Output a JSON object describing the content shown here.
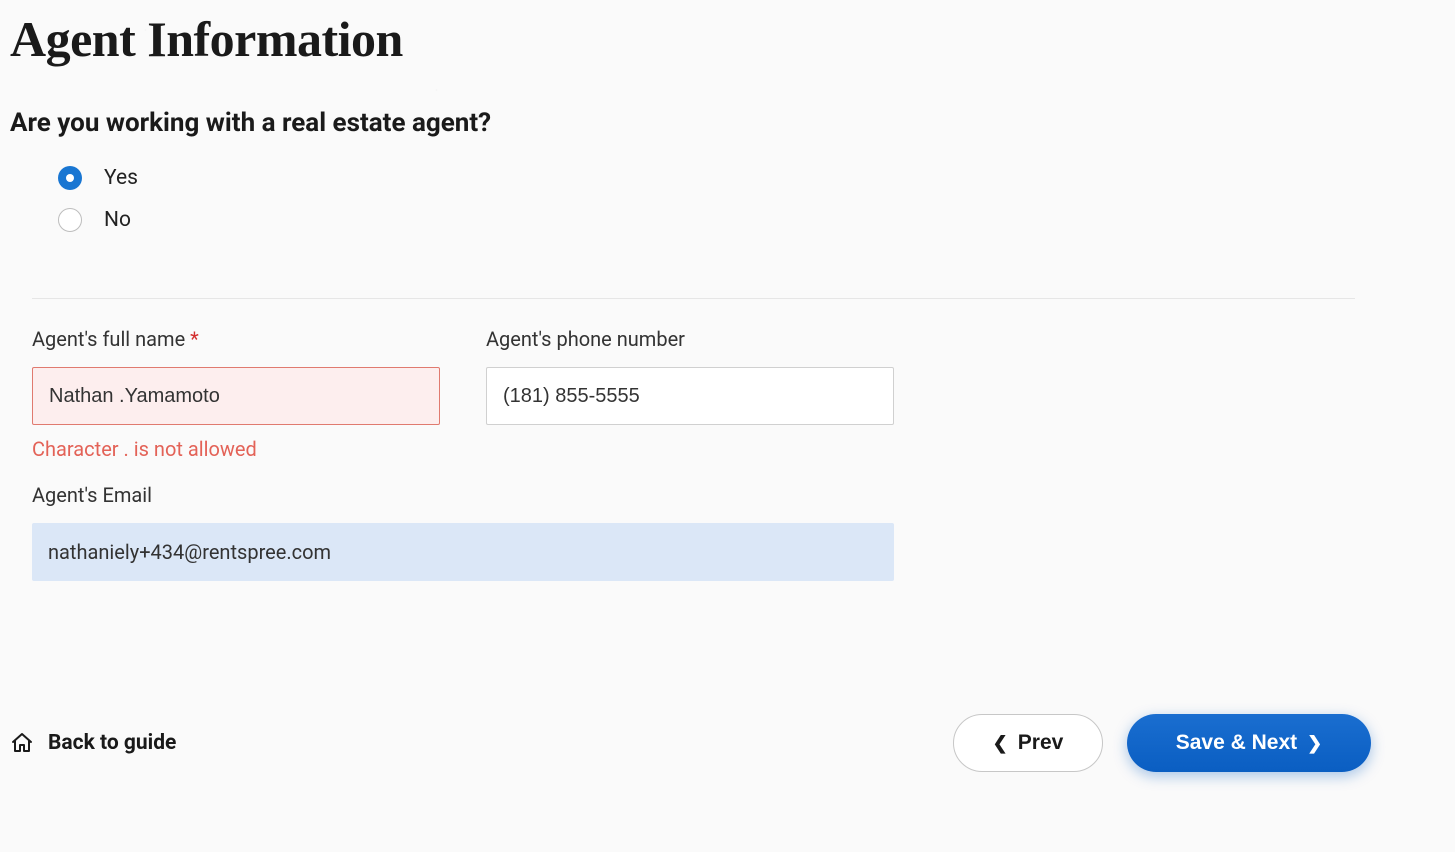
{
  "header": {
    "title": "Agent Information"
  },
  "question": {
    "text": "Are you working with a real estate agent?",
    "options": {
      "yes": "Yes",
      "no": "No"
    }
  },
  "form": {
    "name": {
      "label": "Agent's full name",
      "required_star": "*",
      "value": "Nathan .Yamamoto",
      "error": "Character . is not allowed"
    },
    "phone": {
      "label": "Agent's phone number",
      "value": "(181) 855-5555"
    },
    "email": {
      "label": "Agent's Email",
      "value": "nathaniely+434@rentspree.com"
    }
  },
  "footer": {
    "back": "Back to guide",
    "prev": "Prev",
    "next": "Save & Next"
  }
}
